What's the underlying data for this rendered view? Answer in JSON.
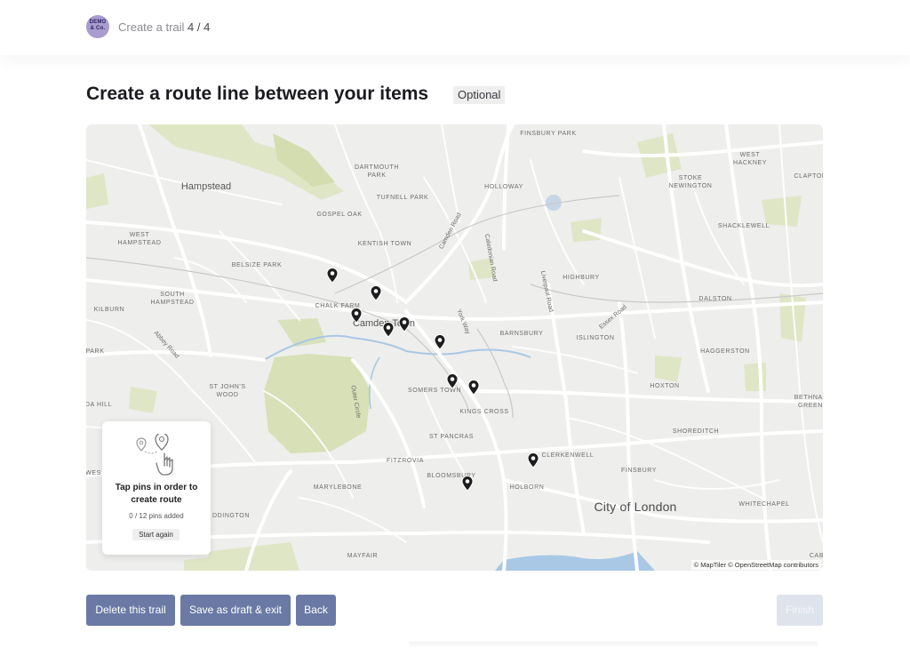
{
  "header": {
    "logo_text": "DEMO\n& Co.",
    "breadcrumb": "Create a trail",
    "step": "4 / 4"
  },
  "page": {
    "title": "Create a route line between your items",
    "optional_badge": "Optional"
  },
  "map": {
    "places": [
      {
        "text": "FINSBURY PARK",
        "style": "small"
      },
      {
        "text": "WEST\nHACKNEY",
        "style": "small"
      },
      {
        "text": "CLAPTON",
        "style": "small"
      },
      {
        "text": "Hampstead",
        "style": "big"
      },
      {
        "text": "DARTMOUTH\nPARK",
        "style": "small"
      },
      {
        "text": "TUFNELL PARK",
        "style": "small"
      },
      {
        "text": "HOLLOWAY",
        "style": "small"
      },
      {
        "text": "STOKE\nNEWINGTON",
        "style": "small"
      },
      {
        "text": "GOSPEL OAK",
        "style": "small"
      },
      {
        "text": "WEST\nHAMPSTEAD",
        "style": "small"
      },
      {
        "text": "KENTISH TOWN",
        "style": "small"
      },
      {
        "text": "SHACKLEWELL",
        "style": "small"
      },
      {
        "text": "BELSIZE PARK",
        "style": "small"
      },
      {
        "text": "HIGHBURY",
        "style": "small"
      },
      {
        "text": "SOUTH\nHAMPSTEAD",
        "style": "small"
      },
      {
        "text": "DALSTON",
        "style": "small"
      },
      {
        "text": "CHALK FARM",
        "style": "small"
      },
      {
        "text": "KILBURN",
        "style": "small"
      },
      {
        "text": "Camden Town",
        "style": "big"
      },
      {
        "text": "BARNSBURY",
        "style": "small"
      },
      {
        "text": "ISLINGTON",
        "style": "small"
      },
      {
        "text": "PARK",
        "style": "small"
      },
      {
        "text": "HAGGERSTON",
        "style": "small"
      },
      {
        "text": "ST JOHN'S\nWOOD",
        "style": "small"
      },
      {
        "text": "SOMERS TOWN",
        "style": "small"
      },
      {
        "text": "HOXTON",
        "style": "small"
      },
      {
        "text": "KINGS CROSS",
        "style": "small"
      },
      {
        "text": "BETHNAL\nGREEN",
        "style": "small"
      },
      {
        "text": "DA HILL",
        "style": "small"
      },
      {
        "text": "SHOREDITCH",
        "style": "small"
      },
      {
        "text": "ST PANCRAS",
        "style": "small"
      },
      {
        "text": "CLERKENWELL",
        "style": "small"
      },
      {
        "text": "FITZROVIA",
        "style": "small"
      },
      {
        "text": "FINSBURY",
        "style": "small"
      },
      {
        "text": "BLOOMSBURY",
        "style": "small"
      },
      {
        "text": "MARYLEBONE",
        "style": "small"
      },
      {
        "text": "HOLBORN",
        "style": "small"
      },
      {
        "text": "City of London",
        "style": "city"
      },
      {
        "text": "WHITECHAPEL",
        "style": "small"
      },
      {
        "text": "DDINGTON",
        "style": "small"
      },
      {
        "text": "MAYFAIR",
        "style": "small"
      },
      {
        "text": "Cab",
        "style": "small"
      },
      {
        "text": "Wes",
        "style": "small"
      }
    ],
    "roads": [
      "Camden Road",
      "Caledonian Road",
      "Liverpool Road",
      "Essex Road",
      "York Way",
      "Abbey Road",
      "Outer Circle"
    ],
    "pin_count": 12,
    "attribution": "© MapTiler © OpenStreetMap contributors"
  },
  "route_panel": {
    "instruction": "Tap pins in order to create route",
    "progress": "0 / 12 pins added",
    "start_again_label": "Start again"
  },
  "footer": {
    "delete_label": "Delete this trail",
    "save_label": "Save as draft & exit",
    "back_label": "Back",
    "finish_label": "Finish",
    "finish_disabled": true
  }
}
